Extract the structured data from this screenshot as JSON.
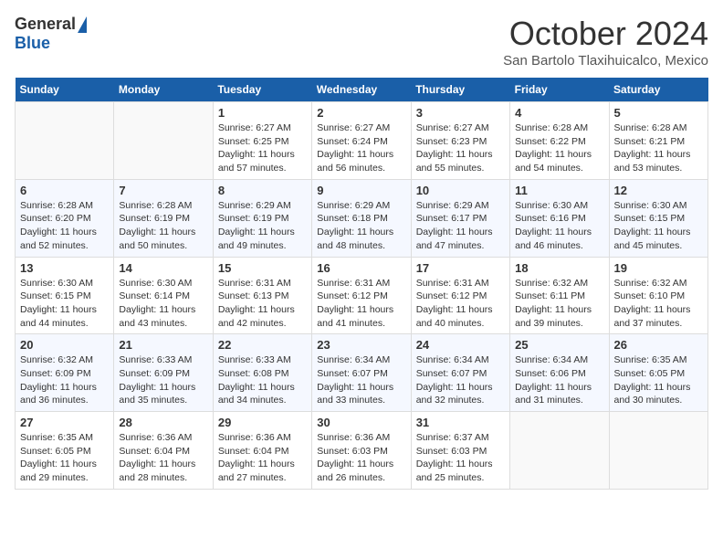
{
  "logo": {
    "general": "General",
    "blue": "Blue"
  },
  "title": {
    "month": "October 2024",
    "location": "San Bartolo Tlaxihuicalco, Mexico"
  },
  "headers": [
    "Sunday",
    "Monday",
    "Tuesday",
    "Wednesday",
    "Thursday",
    "Friday",
    "Saturday"
  ],
  "weeks": [
    [
      {
        "day": "",
        "sunrise": "",
        "sunset": "",
        "daylight": ""
      },
      {
        "day": "",
        "sunrise": "",
        "sunset": "",
        "daylight": ""
      },
      {
        "day": "1",
        "sunrise": "Sunrise: 6:27 AM",
        "sunset": "Sunset: 6:25 PM",
        "daylight": "Daylight: 11 hours and 57 minutes."
      },
      {
        "day": "2",
        "sunrise": "Sunrise: 6:27 AM",
        "sunset": "Sunset: 6:24 PM",
        "daylight": "Daylight: 11 hours and 56 minutes."
      },
      {
        "day": "3",
        "sunrise": "Sunrise: 6:27 AM",
        "sunset": "Sunset: 6:23 PM",
        "daylight": "Daylight: 11 hours and 55 minutes."
      },
      {
        "day": "4",
        "sunrise": "Sunrise: 6:28 AM",
        "sunset": "Sunset: 6:22 PM",
        "daylight": "Daylight: 11 hours and 54 minutes."
      },
      {
        "day": "5",
        "sunrise": "Sunrise: 6:28 AM",
        "sunset": "Sunset: 6:21 PM",
        "daylight": "Daylight: 11 hours and 53 minutes."
      }
    ],
    [
      {
        "day": "6",
        "sunrise": "Sunrise: 6:28 AM",
        "sunset": "Sunset: 6:20 PM",
        "daylight": "Daylight: 11 hours and 52 minutes."
      },
      {
        "day": "7",
        "sunrise": "Sunrise: 6:28 AM",
        "sunset": "Sunset: 6:19 PM",
        "daylight": "Daylight: 11 hours and 50 minutes."
      },
      {
        "day": "8",
        "sunrise": "Sunrise: 6:29 AM",
        "sunset": "Sunset: 6:19 PM",
        "daylight": "Daylight: 11 hours and 49 minutes."
      },
      {
        "day": "9",
        "sunrise": "Sunrise: 6:29 AM",
        "sunset": "Sunset: 6:18 PM",
        "daylight": "Daylight: 11 hours and 48 minutes."
      },
      {
        "day": "10",
        "sunrise": "Sunrise: 6:29 AM",
        "sunset": "Sunset: 6:17 PM",
        "daylight": "Daylight: 11 hours and 47 minutes."
      },
      {
        "day": "11",
        "sunrise": "Sunrise: 6:30 AM",
        "sunset": "Sunset: 6:16 PM",
        "daylight": "Daylight: 11 hours and 46 minutes."
      },
      {
        "day": "12",
        "sunrise": "Sunrise: 6:30 AM",
        "sunset": "Sunset: 6:15 PM",
        "daylight": "Daylight: 11 hours and 45 minutes."
      }
    ],
    [
      {
        "day": "13",
        "sunrise": "Sunrise: 6:30 AM",
        "sunset": "Sunset: 6:15 PM",
        "daylight": "Daylight: 11 hours and 44 minutes."
      },
      {
        "day": "14",
        "sunrise": "Sunrise: 6:30 AM",
        "sunset": "Sunset: 6:14 PM",
        "daylight": "Daylight: 11 hours and 43 minutes."
      },
      {
        "day": "15",
        "sunrise": "Sunrise: 6:31 AM",
        "sunset": "Sunset: 6:13 PM",
        "daylight": "Daylight: 11 hours and 42 minutes."
      },
      {
        "day": "16",
        "sunrise": "Sunrise: 6:31 AM",
        "sunset": "Sunset: 6:12 PM",
        "daylight": "Daylight: 11 hours and 41 minutes."
      },
      {
        "day": "17",
        "sunrise": "Sunrise: 6:31 AM",
        "sunset": "Sunset: 6:12 PM",
        "daylight": "Daylight: 11 hours and 40 minutes."
      },
      {
        "day": "18",
        "sunrise": "Sunrise: 6:32 AM",
        "sunset": "Sunset: 6:11 PM",
        "daylight": "Daylight: 11 hours and 39 minutes."
      },
      {
        "day": "19",
        "sunrise": "Sunrise: 6:32 AM",
        "sunset": "Sunset: 6:10 PM",
        "daylight": "Daylight: 11 hours and 37 minutes."
      }
    ],
    [
      {
        "day": "20",
        "sunrise": "Sunrise: 6:32 AM",
        "sunset": "Sunset: 6:09 PM",
        "daylight": "Daylight: 11 hours and 36 minutes."
      },
      {
        "day": "21",
        "sunrise": "Sunrise: 6:33 AM",
        "sunset": "Sunset: 6:09 PM",
        "daylight": "Daylight: 11 hours and 35 minutes."
      },
      {
        "day": "22",
        "sunrise": "Sunrise: 6:33 AM",
        "sunset": "Sunset: 6:08 PM",
        "daylight": "Daylight: 11 hours and 34 minutes."
      },
      {
        "day": "23",
        "sunrise": "Sunrise: 6:34 AM",
        "sunset": "Sunset: 6:07 PM",
        "daylight": "Daylight: 11 hours and 33 minutes."
      },
      {
        "day": "24",
        "sunrise": "Sunrise: 6:34 AM",
        "sunset": "Sunset: 6:07 PM",
        "daylight": "Daylight: 11 hours and 32 minutes."
      },
      {
        "day": "25",
        "sunrise": "Sunrise: 6:34 AM",
        "sunset": "Sunset: 6:06 PM",
        "daylight": "Daylight: 11 hours and 31 minutes."
      },
      {
        "day": "26",
        "sunrise": "Sunrise: 6:35 AM",
        "sunset": "Sunset: 6:05 PM",
        "daylight": "Daylight: 11 hours and 30 minutes."
      }
    ],
    [
      {
        "day": "27",
        "sunrise": "Sunrise: 6:35 AM",
        "sunset": "Sunset: 6:05 PM",
        "daylight": "Daylight: 11 hours and 29 minutes."
      },
      {
        "day": "28",
        "sunrise": "Sunrise: 6:36 AM",
        "sunset": "Sunset: 6:04 PM",
        "daylight": "Daylight: 11 hours and 28 minutes."
      },
      {
        "day": "29",
        "sunrise": "Sunrise: 6:36 AM",
        "sunset": "Sunset: 6:04 PM",
        "daylight": "Daylight: 11 hours and 27 minutes."
      },
      {
        "day": "30",
        "sunrise": "Sunrise: 6:36 AM",
        "sunset": "Sunset: 6:03 PM",
        "daylight": "Daylight: 11 hours and 26 minutes."
      },
      {
        "day": "31",
        "sunrise": "Sunrise: 6:37 AM",
        "sunset": "Sunset: 6:03 PM",
        "daylight": "Daylight: 11 hours and 25 minutes."
      },
      {
        "day": "",
        "sunrise": "",
        "sunset": "",
        "daylight": ""
      },
      {
        "day": "",
        "sunrise": "",
        "sunset": "",
        "daylight": ""
      }
    ]
  ]
}
